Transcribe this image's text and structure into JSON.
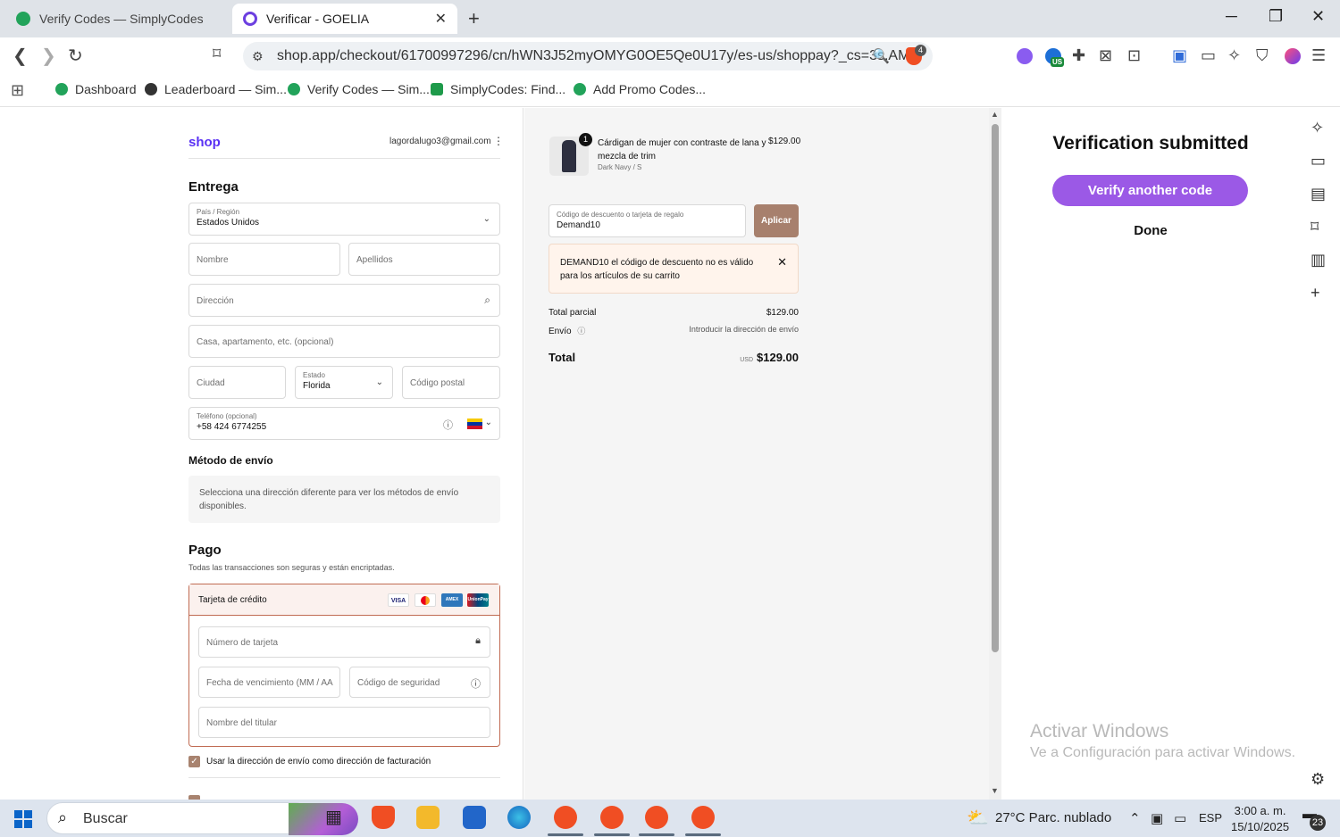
{
  "browser": {
    "tabs": [
      {
        "title": "Verify Codes — SimplyCodes",
        "active": false
      },
      {
        "title": "Verificar - GOELIA",
        "active": true
      }
    ],
    "url": "shop.app/checkout/61700997296/cn/hWN3J52myOMYG0OE5Qe0U17y/es-us/shoppay?_cs=3s.AM...",
    "shield_count": "4",
    "ext_badge": "US",
    "bookmarks": [
      "Dashboard",
      "Leaderboard — Sim...",
      "Verify Codes — Sim...",
      "SimplyCodes: Find...",
      "Add Promo Codes..."
    ]
  },
  "checkout": {
    "logo": "shop",
    "account_email": "lagordalugo3@gmail.com",
    "delivery_title": "Entrega",
    "country_label": "País / Región",
    "country_value": "Estados Unidos",
    "first_name_ph": "Nombre",
    "last_name_ph": "Apellidos",
    "address_ph": "Dirección",
    "apt_ph": "Casa, apartamento, etc. (opcional)",
    "city_ph": "Ciudad",
    "state_label": "Estado",
    "state_value": "Florida",
    "zip_ph": "Código postal",
    "phone_label": "Teléfono (opcional)",
    "phone_value": "+58 424 6774255",
    "shipping_title": "Método de envío",
    "shipping_note": "Selecciona una dirección diferente para ver los métodos de envío disponibles.",
    "payment_title": "Pago",
    "payment_sub": "Todas las transacciones son seguras y están encriptadas.",
    "card_option": "Tarjeta de crédito",
    "card_brands": [
      "VISA",
      "MC",
      "AMEX",
      "UnionPay"
    ],
    "card_number_ph": "Número de tarjeta",
    "expiry_ph": "Fecha de vencimiento (MM / AA",
    "cvv_ph": "Código de seguridad",
    "holder_ph": "Nombre del titular",
    "billing_same_label": "Usar la dirección de envío como dirección de facturación",
    "billing_same_checked": true
  },
  "summary": {
    "product_qty": "1",
    "product_name": "Cárdigan de mujer con contraste de lana y mezcla de trim",
    "product_variant": "Dark Navy / S",
    "product_price": "$129.00",
    "discount_label": "Código de descuento o tarjeta de regalo",
    "discount_value": "Demand10",
    "apply_label": "Aplicar",
    "error_msg": "DEMAND10 el código de descuento no es válido para los artículos de su carrito",
    "subtotal_label": "Total parcial",
    "subtotal_value": "$129.00",
    "shipping_label": "Envío",
    "shipping_value": "Introducir la dirección de envío",
    "total_label": "Total",
    "currency": "USD",
    "total_value": "$129.00"
  },
  "sidepanel": {
    "title": "Verification submitted",
    "verify_another": "Verify another code",
    "done": "Done",
    "watermark_title": "Activar Windows",
    "watermark_sub": "Ve a Configuración para activar Windows."
  },
  "taskbar": {
    "search_placeholder": "Buscar",
    "weather": "27°C  Parc. nublado",
    "lang": "ESP",
    "time": "3:00 a. m.",
    "date": "15/10/2025",
    "notifications": "23"
  }
}
